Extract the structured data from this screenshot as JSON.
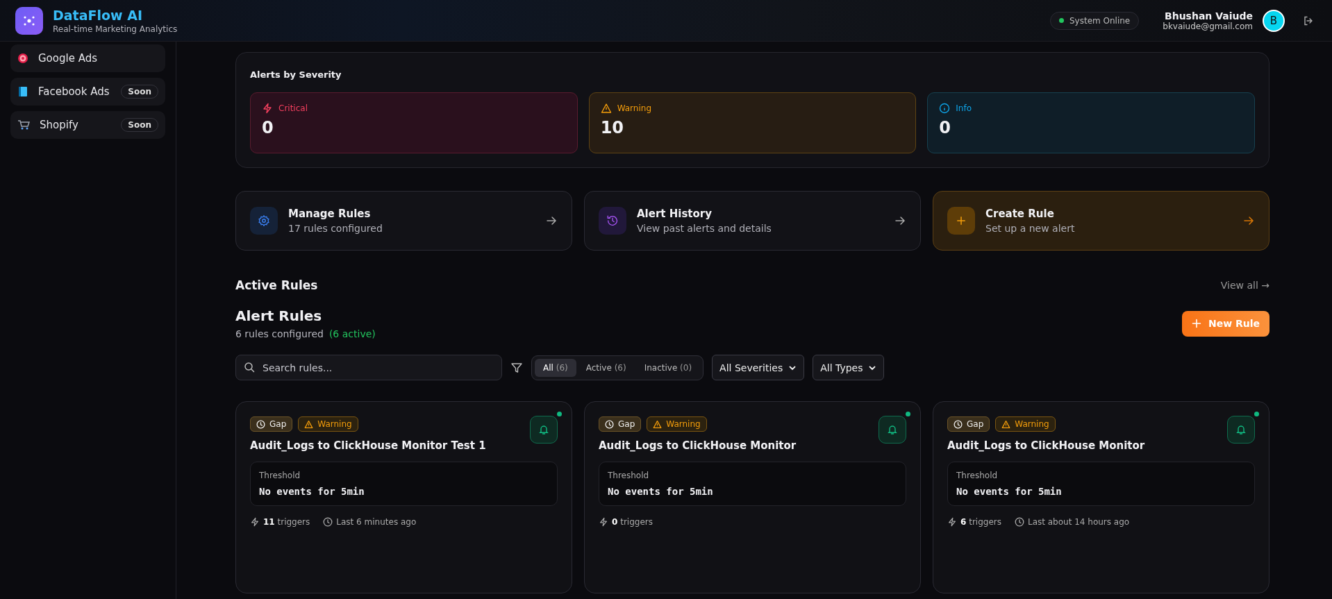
{
  "header": {
    "app_name": "DataFlow AI",
    "tagline": "Real-time Marketing Analytics",
    "status": "System Online",
    "online": true,
    "user_name": "Bhushan Vaiude",
    "user_email": "bkvaiude@gmail.com",
    "avatar_letter": "B"
  },
  "sidebar": {
    "items": [
      {
        "kind": "google",
        "label": "Google Ads"
      },
      {
        "kind": "facebook",
        "label": "Facebook Ads",
        "badge": "Soon"
      },
      {
        "kind": "shopify",
        "label": "Shopify",
        "badge": "Soon"
      }
    ]
  },
  "severity": {
    "title": "Alerts by Severity",
    "cards": [
      {
        "kind": "critical",
        "label": "Critical",
        "count": "0"
      },
      {
        "kind": "warning",
        "label": "Warning",
        "count": "10"
      },
      {
        "kind": "info",
        "label": "Info",
        "count": "0"
      }
    ]
  },
  "actions": [
    {
      "kind": "manage",
      "title": "Manage Rules",
      "subtitle": "17 rules configured"
    },
    {
      "kind": "history",
      "title": "Alert History",
      "subtitle": "View past alerts and details"
    },
    {
      "kind": "create",
      "title": "Create Rule",
      "subtitle": "Set up a new alert"
    }
  ],
  "active_rules": {
    "title": "Active Rules",
    "link": "View all →"
  },
  "alert_rules": {
    "title": "Alert Rules",
    "summary": "6 rules configured",
    "active_count": "(6 active)",
    "new_button": "New Rule",
    "search_placeholder": "Search rules...",
    "tabs": [
      {
        "label": "All",
        "count": "(6)",
        "selected": true
      },
      {
        "label": "Active",
        "count": "(6)",
        "selected": false
      },
      {
        "label": "Inactive",
        "count": "(0)",
        "selected": false
      }
    ],
    "filters": [
      "All Severities",
      "All Types"
    ]
  },
  "rules": [
    {
      "type": "Gap",
      "severity": "Warning",
      "name": "Audit_Logs to ClickHouse Monitor Test 1",
      "active": true,
      "threshold_label": "Threshold",
      "threshold": "No events for 5min",
      "triggers": "11",
      "triggers_label": "triggers",
      "last": "Last 6 minutes ago"
    },
    {
      "type": "Gap",
      "severity": "Warning",
      "name": "Audit_Logs to ClickHouse Monitor",
      "active": true,
      "threshold_label": "Threshold",
      "threshold": "No events for 5min",
      "triggers": "0",
      "triggers_label": "triggers"
    },
    {
      "type": "Gap",
      "severity": "Warning",
      "name": "Audit_Logs to ClickHouse Monitor",
      "active": true,
      "threshold_label": "Threshold",
      "threshold": "No events for 5min",
      "triggers": "6",
      "triggers_label": "triggers",
      "last": "Last about 14 hours ago"
    }
  ]
}
